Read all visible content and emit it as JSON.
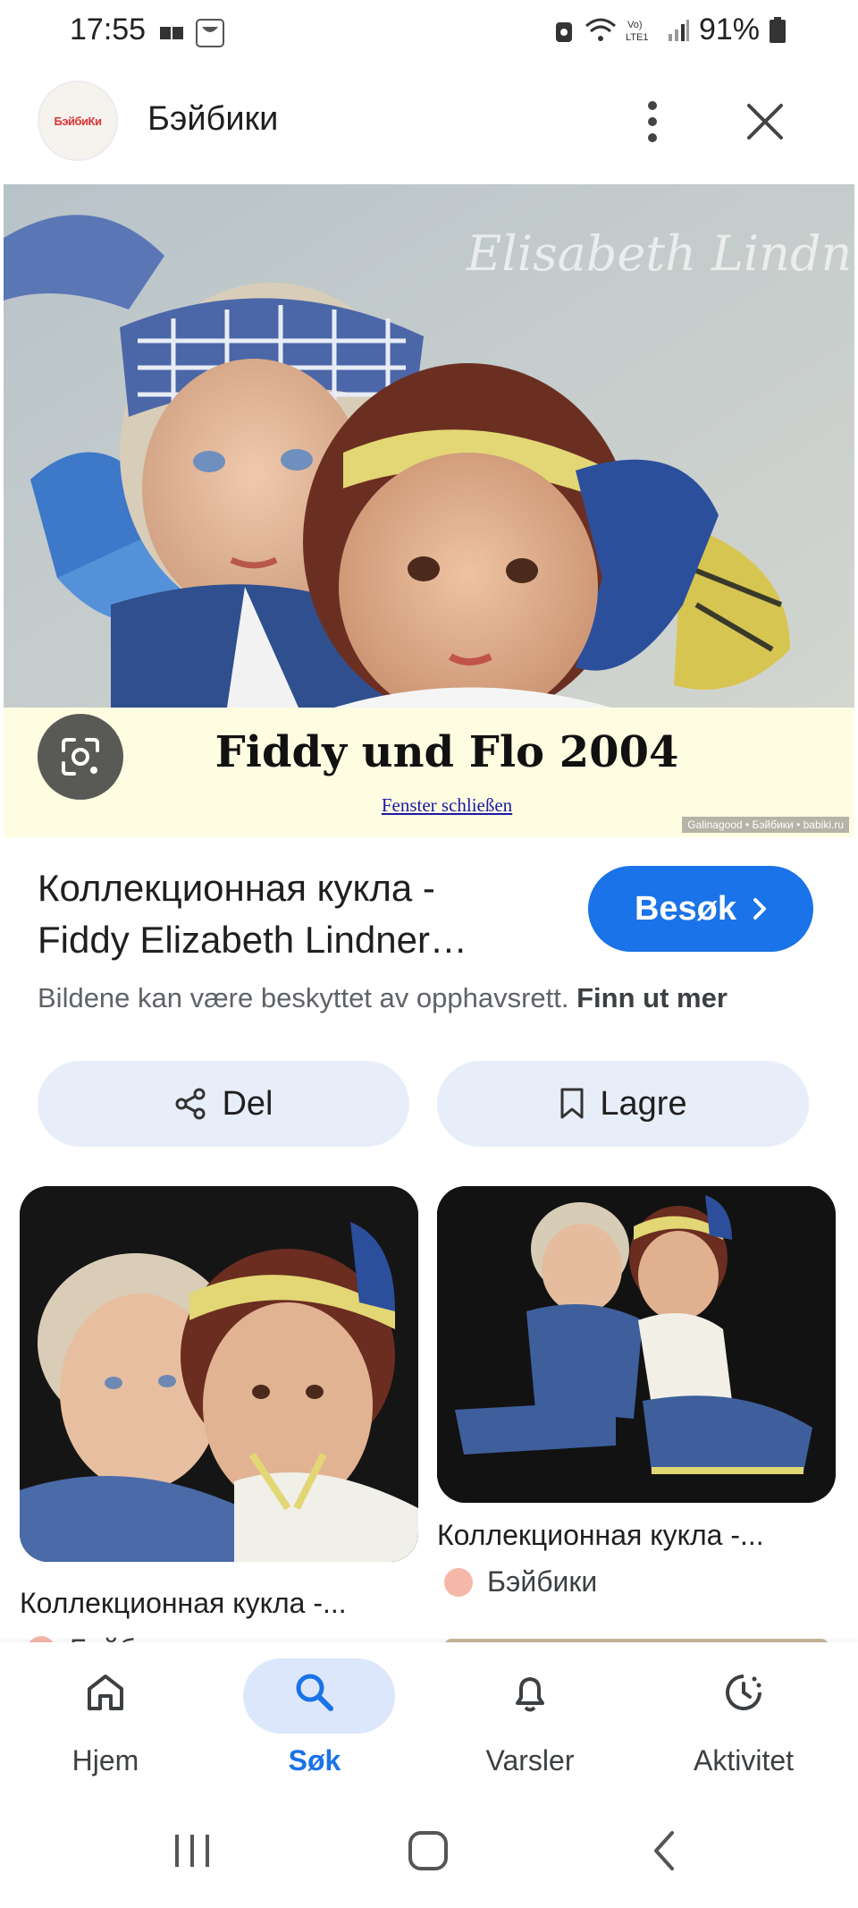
{
  "status_bar": {
    "time": "17:55",
    "battery": "91%",
    "network": "Vo) LTE1"
  },
  "header": {
    "site_name": "Бэйбики",
    "logo_text": "БэйбиКи"
  },
  "hero": {
    "signature": "Elisabeth Lindner",
    "caption_title": "Fiddy und Flo 2004",
    "caption_link": "Fenster schließen",
    "watermark": "Galinagood • Бэйбики • babiki.ru"
  },
  "result": {
    "title_line1": "Коллекционная кукла -",
    "title_line2": "Fiddy Elizabeth Lindner…",
    "visit_label": "Besøk",
    "copyright_text": "Bildene kan være beskyttet av opphavsrett.",
    "learn_more": "Finn ut mer"
  },
  "actions": {
    "share_label": "Del",
    "save_label": "Lagre"
  },
  "related": [
    {
      "caption": "Коллекционная кукла -...",
      "source": "Бэйбики"
    },
    {
      "caption": "Коллекционная кукла -...",
      "source": "Бэйбики"
    }
  ],
  "bottom_nav": {
    "items": [
      {
        "label": "Hjem",
        "icon": "home-icon"
      },
      {
        "label": "Søk",
        "icon": "search-icon"
      },
      {
        "label": "Varsler",
        "icon": "bell-icon"
      },
      {
        "label": "Aktivitet",
        "icon": "activity-icon"
      }
    ],
    "active": "Søk"
  },
  "colors": {
    "accent": "#1a73e8",
    "pill": "#e8eef9",
    "nav_active_pill": "#dde7fb",
    "caption_bg": "#fffde1"
  }
}
